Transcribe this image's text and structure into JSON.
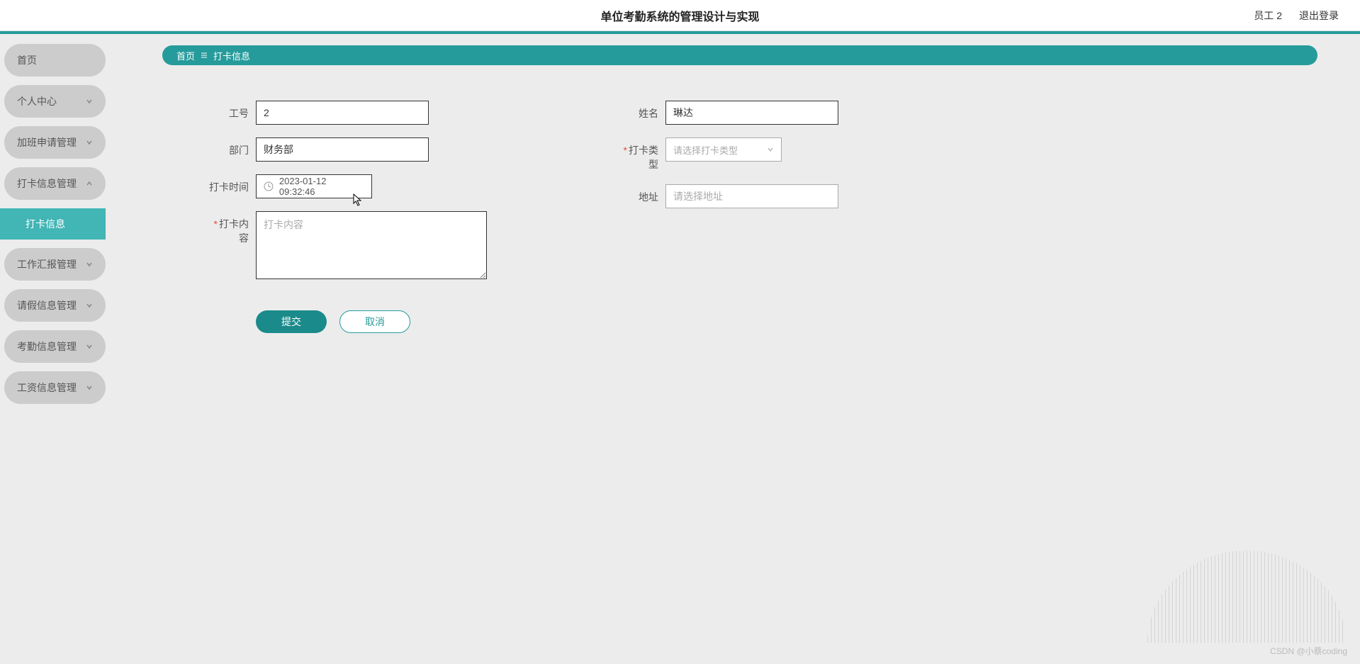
{
  "header": {
    "title": "单位考勤系统的管理设计与实现",
    "user": "员工 2",
    "logout": "退出登录"
  },
  "sidebar": {
    "items": [
      {
        "label": "首页",
        "expandable": false
      },
      {
        "label": "个人中心",
        "expandable": true
      },
      {
        "label": "加班申请管理",
        "expandable": true
      },
      {
        "label": "打卡信息管理",
        "expandable": true,
        "expanded": true,
        "children": [
          {
            "label": "打卡信息"
          }
        ]
      },
      {
        "label": "工作汇报管理",
        "expandable": true
      },
      {
        "label": "请假信息管理",
        "expandable": true
      },
      {
        "label": "考勤信息管理",
        "expandable": true
      },
      {
        "label": "工资信息管理",
        "expandable": true
      }
    ]
  },
  "breadcrumb": {
    "home": "首页",
    "current": "打卡信息"
  },
  "form": {
    "gonghao": {
      "label": "工号",
      "value": "2"
    },
    "xingming": {
      "label": "姓名",
      "value": "琳达"
    },
    "bumen": {
      "label": "部门",
      "value": "财务部"
    },
    "dakaleixing": {
      "label": "打卡类型",
      "placeholder": "请选择打卡类型",
      "required": true
    },
    "dakashijian": {
      "label": "打卡时间",
      "value": "2023-01-12 09:32:46"
    },
    "dizhi": {
      "label": "地址",
      "placeholder": "请选择地址"
    },
    "dakaneirong": {
      "label": "打卡内容",
      "placeholder": "打卡内容",
      "required": true
    }
  },
  "buttons": {
    "submit": "提交",
    "cancel": "取消"
  },
  "watermark": "CSDN @小蔡coding"
}
